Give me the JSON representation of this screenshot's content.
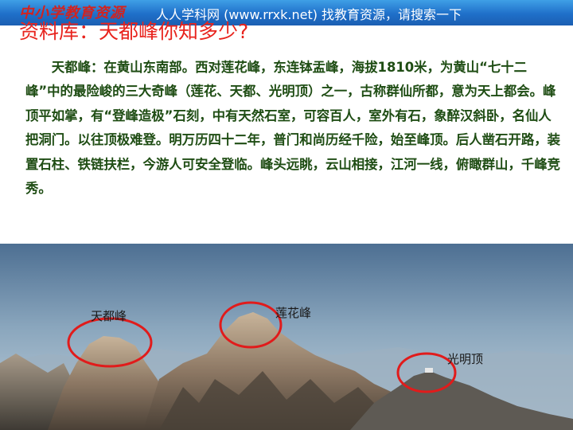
{
  "banner": {
    "logo_text": "中小学教育资源",
    "text": "人人学科网 (www.rrxk.net) 找教育资源，请搜索一下"
  },
  "title": "资料库：天都峰你知多少?",
  "body": "天都峰：在黄山东南部。西对莲花峰，东连钵盂峰，海拔1810米，为黄山“七十二峰”中的最险峻的三大奇峰（莲花、天都、光明顶）之一，古称群仙所都，意为天上都会。峰顶平如掌，有“登峰造极”石刻，中有天然石室，可容百人，室外有石，象醉汉斜卧，名仙人把洞门。以往顶极难登。明万历四十二年，普门和尚历经千险，始至峰顶。后人凿石开路，装置石柱、铁链扶栏，今游人可安全登临。峰头远眺，云山相接，江河一线，俯瞰群山，千峰竞秀。",
  "photo": {
    "labels": {
      "tiandu": "天都峰",
      "lianhua": "莲花峰",
      "guangming": "光明顶"
    }
  },
  "colors": {
    "title": "#e8231d",
    "body": "#1f4d14",
    "banner": "#1f6fc9",
    "circle": "#e11b1b"
  }
}
